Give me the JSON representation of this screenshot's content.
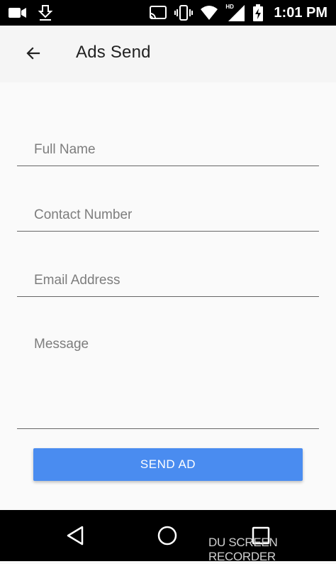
{
  "status_bar": {
    "time": "1:01",
    "ampm": "PM",
    "network_label": "HD",
    "icons": [
      "video-camera-icon",
      "download-icon",
      "cast-icon",
      "vibrate-icon",
      "wifi-icon",
      "signal-icon",
      "battery-charging-icon"
    ]
  },
  "app_bar": {
    "title": "Ads Send",
    "back_icon": "arrow-back-icon"
  },
  "form": {
    "full_name": {
      "placeholder": "Full Name",
      "value": ""
    },
    "contact_number": {
      "placeholder": "Contact Number",
      "value": ""
    },
    "email_address": {
      "placeholder": "Email Address",
      "value": ""
    },
    "message": {
      "placeholder": "Message",
      "value": ""
    },
    "submit_label": "SEND AD"
  },
  "nav_bar": {
    "icons": [
      "nav-back-icon",
      "nav-home-icon",
      "nav-recents-icon"
    ],
    "watermark": "DU SCREEN RECORDER"
  },
  "colors": {
    "button": "#4a8cf0",
    "status_bar": "#000000",
    "app_bar": "#f5f5f5",
    "background": "#fafafa"
  }
}
